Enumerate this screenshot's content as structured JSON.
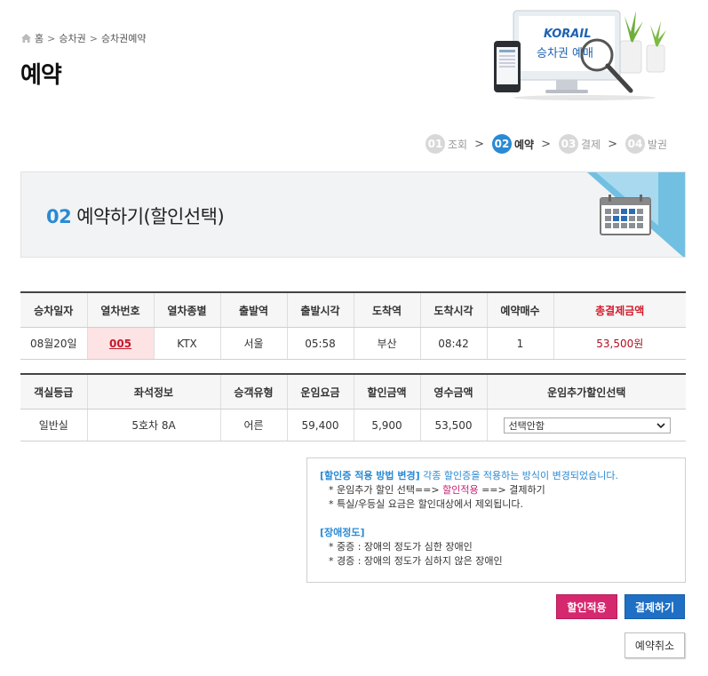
{
  "breadcrumb": {
    "home": "홈",
    "level1": "승차권",
    "level2": "승차권예약"
  },
  "page_title": "예약",
  "hero": {
    "logo": "KORAIL",
    "screen_text": "승차권 예매"
  },
  "steps": [
    {
      "num": "01",
      "label": "조회"
    },
    {
      "num": "02",
      "label": "예약"
    },
    {
      "num": "03",
      "label": "결제"
    },
    {
      "num": "04",
      "label": "발권"
    }
  ],
  "banner": {
    "step_no": "02",
    "title": "예약하기(할인선택)"
  },
  "train_table": {
    "headers": [
      "승차일자",
      "열차번호",
      "열차종별",
      "출발역",
      "출발시각",
      "도착역",
      "도착시각",
      "예약매수",
      "총결제금액"
    ],
    "row": [
      "08월20일",
      "005",
      "KTX",
      "서울",
      "05:58",
      "부산",
      "08:42",
      "1",
      "53,500원"
    ]
  },
  "seat_table": {
    "headers": [
      "객실등급",
      "좌석정보",
      "승객유형",
      "운임요금",
      "할인금액",
      "영수금액",
      "운임추가할인선택"
    ],
    "row": [
      "일반실",
      "5호차 8A",
      "어른",
      "59,400",
      "5,900",
      "53,500"
    ],
    "select_value": "선택안함"
  },
  "notice": {
    "head1": "[할인증 적용 방법 변경]",
    "head1_rest": " 각종 할인증을 적용하는 방식이 변경되었습니다.",
    "line1a": "* 운임추가 할인 선택==> ",
    "line1b": "할인적용",
    "line1c": " ==> 결제하기",
    "line2": "* 특실/우등실 요금은 할인대상에서 제외됩니다.",
    "head2": "[장애정도]",
    "line3": "* 중증 : 장애의 정도가 심한 장애인",
    "line4": "* 경증 : 장애의 정도가 심하지 않은 장애인"
  },
  "buttons": {
    "discount": "할인적용",
    "pay": "결제하기",
    "cancel": "예약취소"
  },
  "colors": {
    "accent_blue": "#2a8ad4",
    "pink": "#d6286e",
    "pay_blue": "#1f6fc4",
    "total_red": "#d11a2a"
  }
}
